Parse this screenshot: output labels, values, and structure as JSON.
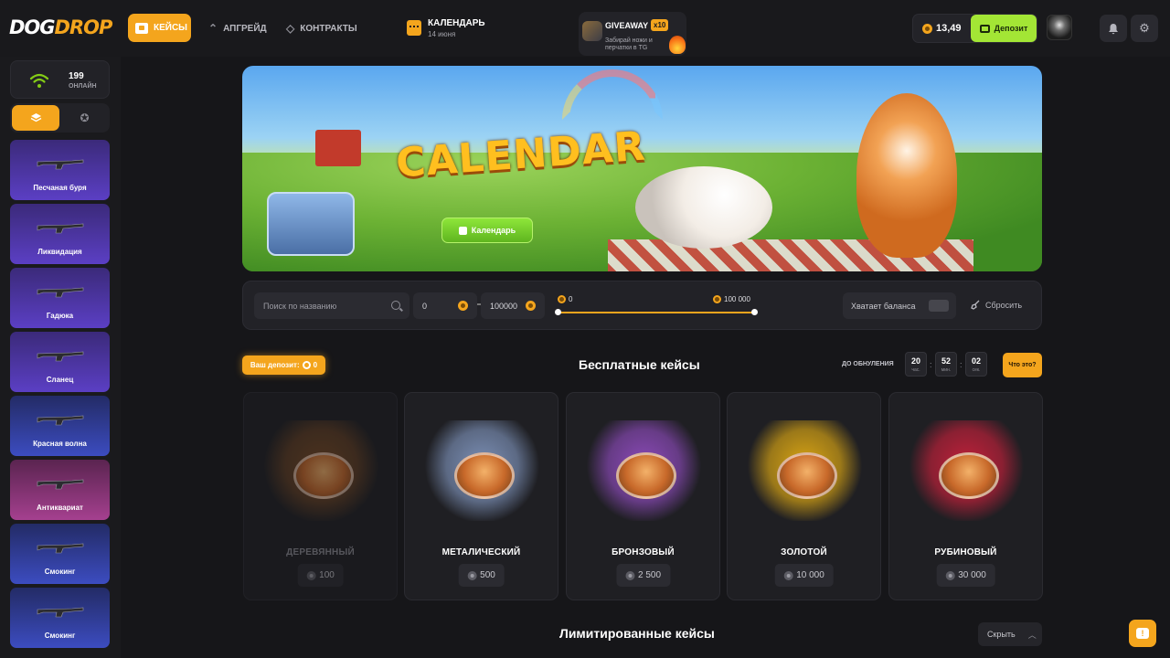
{
  "header": {
    "logo_main": "DOG",
    "logo_accent": "DROP",
    "nav": {
      "cases": "КЕЙСЫ",
      "upgrade": "АПГРЕЙД",
      "contracts": "КОНТРАКТЫ"
    },
    "calendar": {
      "title": "КАЛЕНДАРЬ",
      "date": "14 июня"
    },
    "giveaway": {
      "title": "GIVEAWAY",
      "badge": "x10",
      "text": "Забирай ножи и перчатки в TG"
    },
    "balance": "13,49",
    "deposit_label": "Депозит"
  },
  "sidebar": {
    "online_count": "199",
    "online_label": "ОНЛАЙН",
    "drops": [
      {
        "name": "Песчаная буря",
        "color": "purple"
      },
      {
        "name": "Ликвидация",
        "color": "purple"
      },
      {
        "name": "Гадюка",
        "color": "purple"
      },
      {
        "name": "Сланец",
        "color": "purple"
      },
      {
        "name": "Красная волна",
        "color": "blue"
      },
      {
        "name": "Антиквариат",
        "color": "pink"
      },
      {
        "name": "Смокинг",
        "color": "blue"
      },
      {
        "name": "Смокинг",
        "color": "blue"
      }
    ]
  },
  "banner": {
    "title": "CALENDAR",
    "button": "Календарь"
  },
  "filters": {
    "search_placeholder": "Поиск по названию",
    "min_value": "0",
    "max_value": "100000",
    "slider_min": "0",
    "slider_max": "100 000",
    "enough_balance": "Хватает баланса",
    "reset": "Сбросить"
  },
  "free_cases": {
    "deposit_badge": "Ваш депозит:",
    "deposit_value": "0",
    "title": "Бесплатные кейсы",
    "reset_label": "ДО ОБНУЛЕНИЯ",
    "timer": [
      {
        "value": "20",
        "unit": "час."
      },
      {
        "value": "52",
        "unit": "мин."
      },
      {
        "value": "02",
        "unit": "сек."
      }
    ],
    "what_button": "Что это?",
    "cases": [
      {
        "name": "ДЕРЕВЯННЫЙ",
        "price": "100",
        "dim": true,
        "color": "#7a4a23"
      },
      {
        "name": "МЕТАЛИЧЕСКИЙ",
        "price": "500",
        "dim": false,
        "color": "#7b8fb5"
      },
      {
        "name": "БРОНЗОВЫЙ",
        "price": "2 500",
        "dim": false,
        "color": "#8b4ab8"
      },
      {
        "name": "ЗОЛОТОЙ",
        "price": "10 000",
        "dim": false,
        "color": "#d9a514"
      },
      {
        "name": "РУБИНОВЫЙ",
        "price": "30 000",
        "dim": false,
        "color": "#c0203a"
      }
    ]
  },
  "limited": {
    "title": "Лимитированные кейсы",
    "hide": "Скрыть"
  },
  "colors": {
    "accent": "#f4a51d",
    "deposit_green": "#a3e635",
    "background": "#161619"
  }
}
